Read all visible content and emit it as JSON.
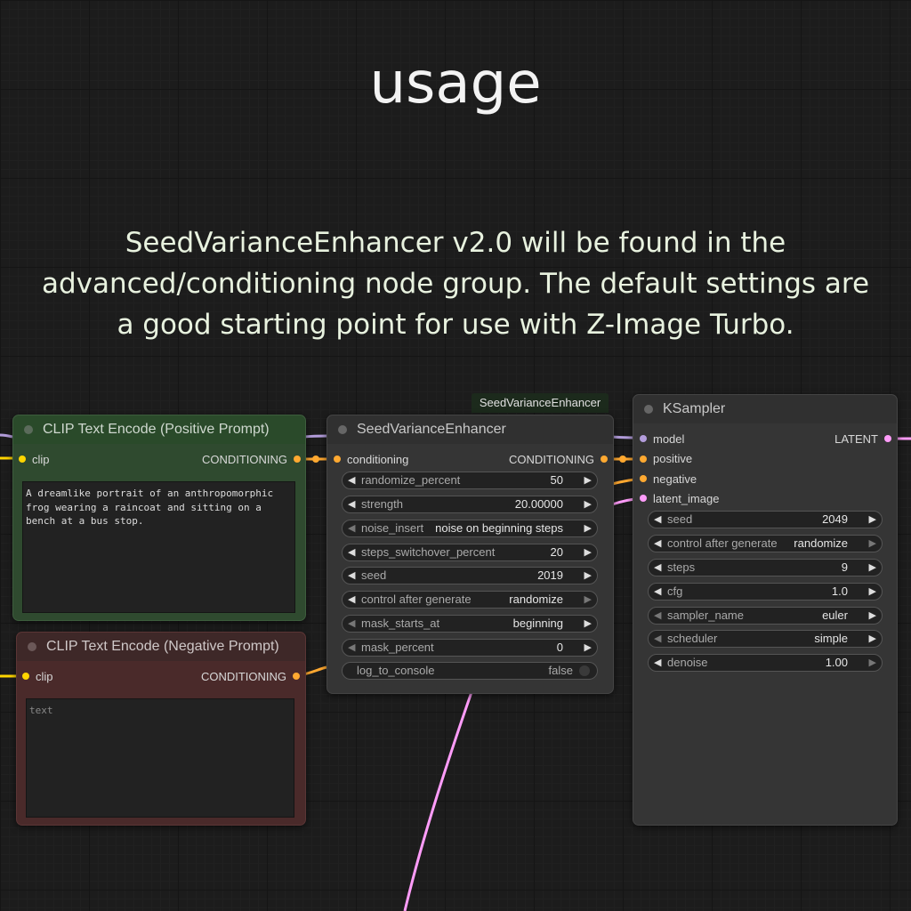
{
  "heading": "usage",
  "description": "SeedVarianceEnhancer v2.0 will be found in the advanced/conditioning node group. The default settings are a good starting point for use with Z-Image Turbo.",
  "badge": "SeedVarianceEnhancer",
  "colors": {
    "conditioning_wire": "#ffa931",
    "model_wire": "#b39ddb",
    "latent_wire": "#ff9cf9",
    "clip_wire": "#ffd500",
    "positive_node": "#2f4a2f",
    "negative_node": "#4a2a2a"
  },
  "positive": {
    "title": "CLIP Text Encode (Positive Prompt)",
    "input": "clip",
    "output": "CONDITIONING",
    "text": "A dreamlike portrait of an anthropomorphic frog wearing a raincoat and sitting on a bench at a bus stop."
  },
  "negative": {
    "title": "CLIP Text Encode (Negative Prompt)",
    "input": "clip",
    "output": "CONDITIONING",
    "placeholder": "text"
  },
  "sve": {
    "title": "SeedVarianceEnhancer",
    "input": "conditioning",
    "output": "CONDITIONING",
    "widgets": [
      {
        "label": "randomize_percent",
        "value": "50"
      },
      {
        "label": "strength",
        "value": "20.00000"
      },
      {
        "label": "noise_insert",
        "value": "noise on beginning steps"
      },
      {
        "label": "steps_switchover_percent",
        "value": "20"
      },
      {
        "label": "seed",
        "value": "2019"
      },
      {
        "label": "control after generate",
        "value": "randomize"
      },
      {
        "label": "mask_starts_at",
        "value": "beginning"
      },
      {
        "label": "mask_percent",
        "value": "0"
      }
    ],
    "toggle": {
      "label": "log_to_console",
      "value": "false"
    }
  },
  "ksampler": {
    "title": "KSampler",
    "inputs": {
      "model": "model",
      "positive": "positive",
      "negative": "negative",
      "latent_image": "latent_image"
    },
    "output": "LATENT",
    "widgets": [
      {
        "label": "seed",
        "value": "2049"
      },
      {
        "label": "control after generate",
        "value": "randomize"
      },
      {
        "label": "steps",
        "value": "9"
      },
      {
        "label": "cfg",
        "value": "1.0"
      },
      {
        "label": "sampler_name",
        "value": "euler"
      },
      {
        "label": "scheduler",
        "value": "simple"
      },
      {
        "label": "denoise",
        "value": "1.00"
      }
    ]
  }
}
